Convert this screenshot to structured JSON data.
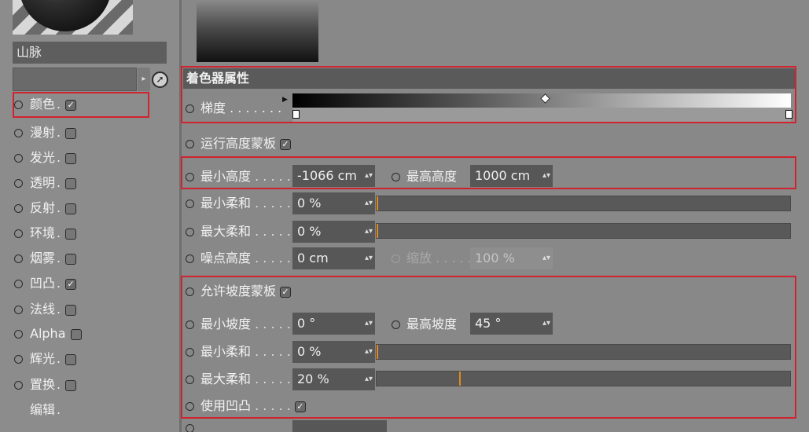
{
  "left_panel": {
    "material_name": "山脉",
    "channels": [
      {
        "label": "颜色",
        "checked": true
      },
      {
        "label": "漫射",
        "checked": false
      },
      {
        "label": "发光",
        "checked": false
      },
      {
        "label": "透明",
        "checked": false
      },
      {
        "label": "反射",
        "checked": false
      },
      {
        "label": "环境",
        "checked": false
      },
      {
        "label": "烟雾",
        "checked": false
      },
      {
        "label": "凹凸",
        "checked": true
      },
      {
        "label": "法线",
        "checked": false
      },
      {
        "label": "Alpha",
        "checked": false
      },
      {
        "label": "辉光",
        "checked": false
      },
      {
        "label": "置换",
        "checked": false
      }
    ],
    "edit_label": "编辑"
  },
  "section_header": "着色器属性",
  "gradient_label": "梯度",
  "run_height_mask_label": "运行高度蒙板",
  "min_height_label": "最小高度",
  "min_height_value": "-1066 cm",
  "max_height_label": "最高高度",
  "max_height_value": "1000 cm",
  "min_soft_1_label": "最小柔和",
  "min_soft_1_value": "0 %",
  "max_soft_1_label": "最大柔和",
  "max_soft_1_value": "0 %",
  "noise_height_label": "噪点高度",
  "noise_height_value": "0 cm",
  "scale_label": "缩放",
  "scale_value": "100 %",
  "allow_slope_mask_label": "允许坡度蒙板",
  "min_slope_label": "最小坡度",
  "min_slope_value": "0 °",
  "max_slope_label": "最高坡度",
  "max_slope_value": "45 °",
  "min_soft_2_label": "最小柔和",
  "min_soft_2_value": "0 %",
  "max_soft_2_label": "最大柔和",
  "max_soft_2_value": "20 %",
  "use_bump_label": "使用凹凸",
  "sliders": {
    "min_soft_1": 0,
    "max_soft_1": 0,
    "min_soft_2": 0,
    "max_soft_2": 20
  },
  "colors": {
    "highlight": "#d0232f",
    "slider_knob": "#e08a1e"
  }
}
